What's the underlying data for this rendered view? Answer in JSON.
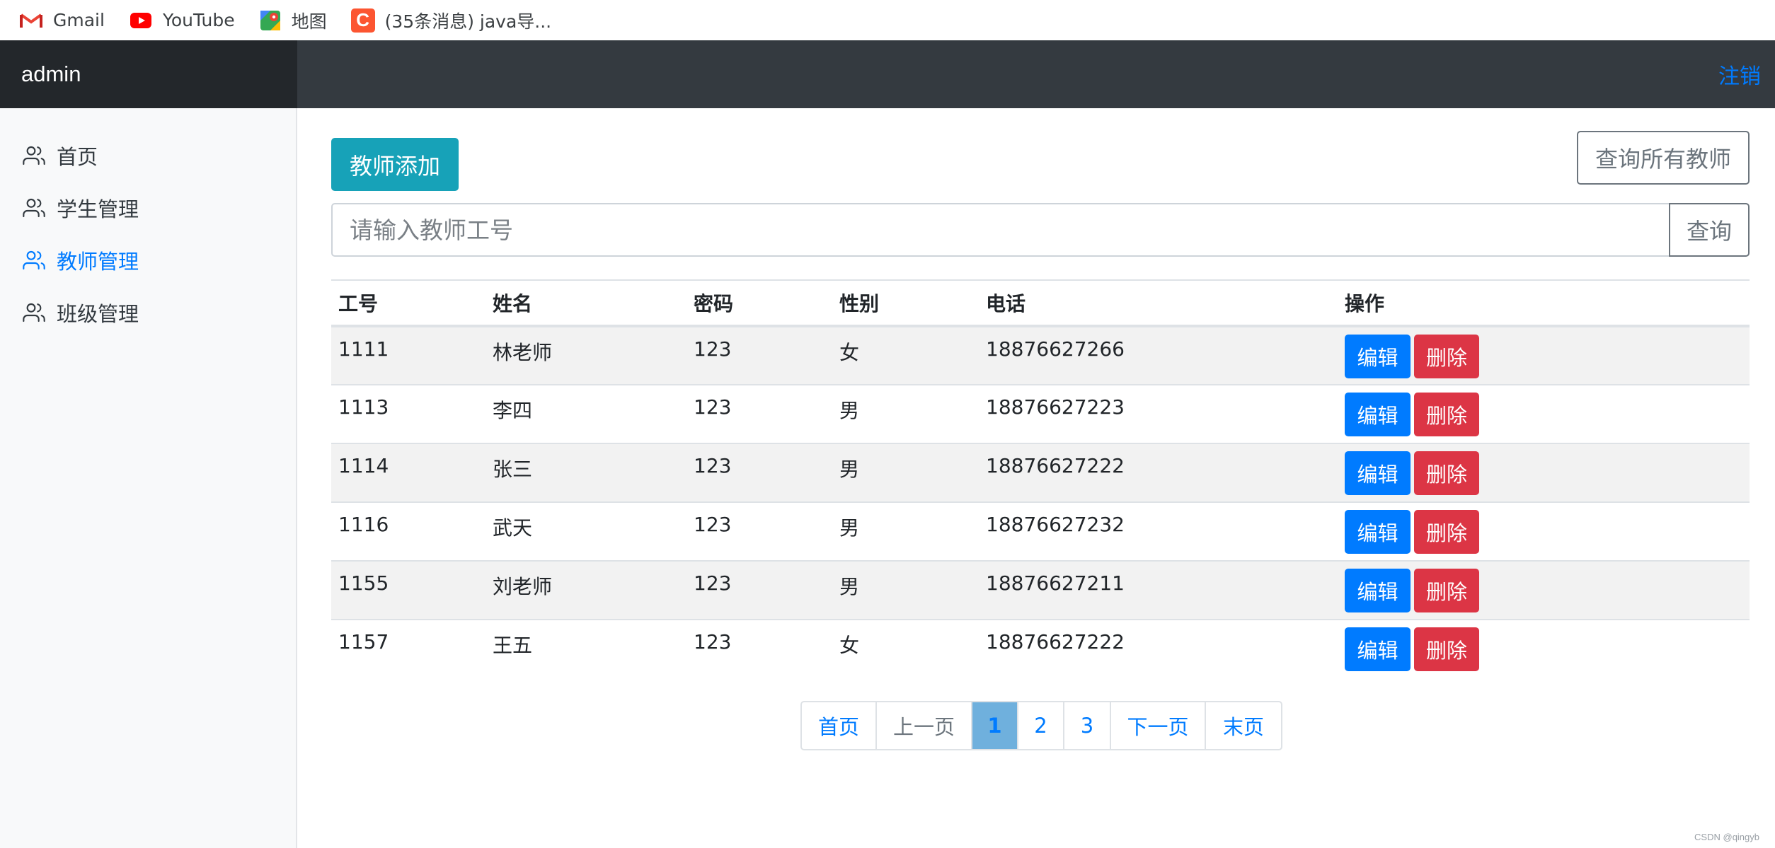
{
  "bookmarks": [
    {
      "label": "Gmail",
      "icon": "gmail-icon"
    },
    {
      "label": "YouTube",
      "icon": "youtube-icon"
    },
    {
      "label": "地图",
      "icon": "maps-icon"
    },
    {
      "label": "(35条消息) java导...",
      "icon": "csdn-icon",
      "icon_text": "C"
    }
  ],
  "navbar": {
    "brand": "admin",
    "logout": "注销"
  },
  "sidebar": {
    "items": [
      {
        "label": "首页",
        "icon": "users-icon",
        "active": false
      },
      {
        "label": "学生管理",
        "icon": "users-icon",
        "active": false
      },
      {
        "label": "教师管理",
        "icon": "users-icon",
        "active": true
      },
      {
        "label": "班级管理",
        "icon": "users-icon",
        "active": false
      }
    ]
  },
  "main": {
    "add_button": "教师添加",
    "query_all_button": "查询所有教师",
    "search": {
      "placeholder": "请输入教师工号",
      "value": ""
    },
    "query_button": "查询"
  },
  "table": {
    "columns": [
      "工号",
      "姓名",
      "密码",
      "性别",
      "电话",
      "操作"
    ],
    "edit_label": "编辑",
    "delete_label": "删除",
    "rows": [
      [
        "1111",
        "林老师",
        "123",
        "女",
        "18876627266"
      ],
      [
        "1113",
        "李四",
        "123",
        "男",
        "18876627223"
      ],
      [
        "1114",
        "张三",
        "123",
        "男",
        "18876627222"
      ],
      [
        "1116",
        "武天",
        "123",
        "男",
        "18876627232"
      ],
      [
        "1155",
        "刘老师",
        "123",
        "男",
        "18876627211"
      ],
      [
        "1157",
        "王五",
        "123",
        "女",
        "18876627222"
      ]
    ]
  },
  "pagination": {
    "first": "首页",
    "prev": "上一页",
    "pages": [
      "1",
      "2",
      "3"
    ],
    "current": "1",
    "next": "下一页",
    "last": "末页"
  },
  "watermark": "CSDN @qingyb",
  "colors": {
    "navbar": "#343a40",
    "brand_bg": "#23272b",
    "link": "#007bff",
    "info": "#17a2b8",
    "danger": "#dc3545",
    "secondary": "#6c757d",
    "active_page": "#6fb0dd"
  }
}
